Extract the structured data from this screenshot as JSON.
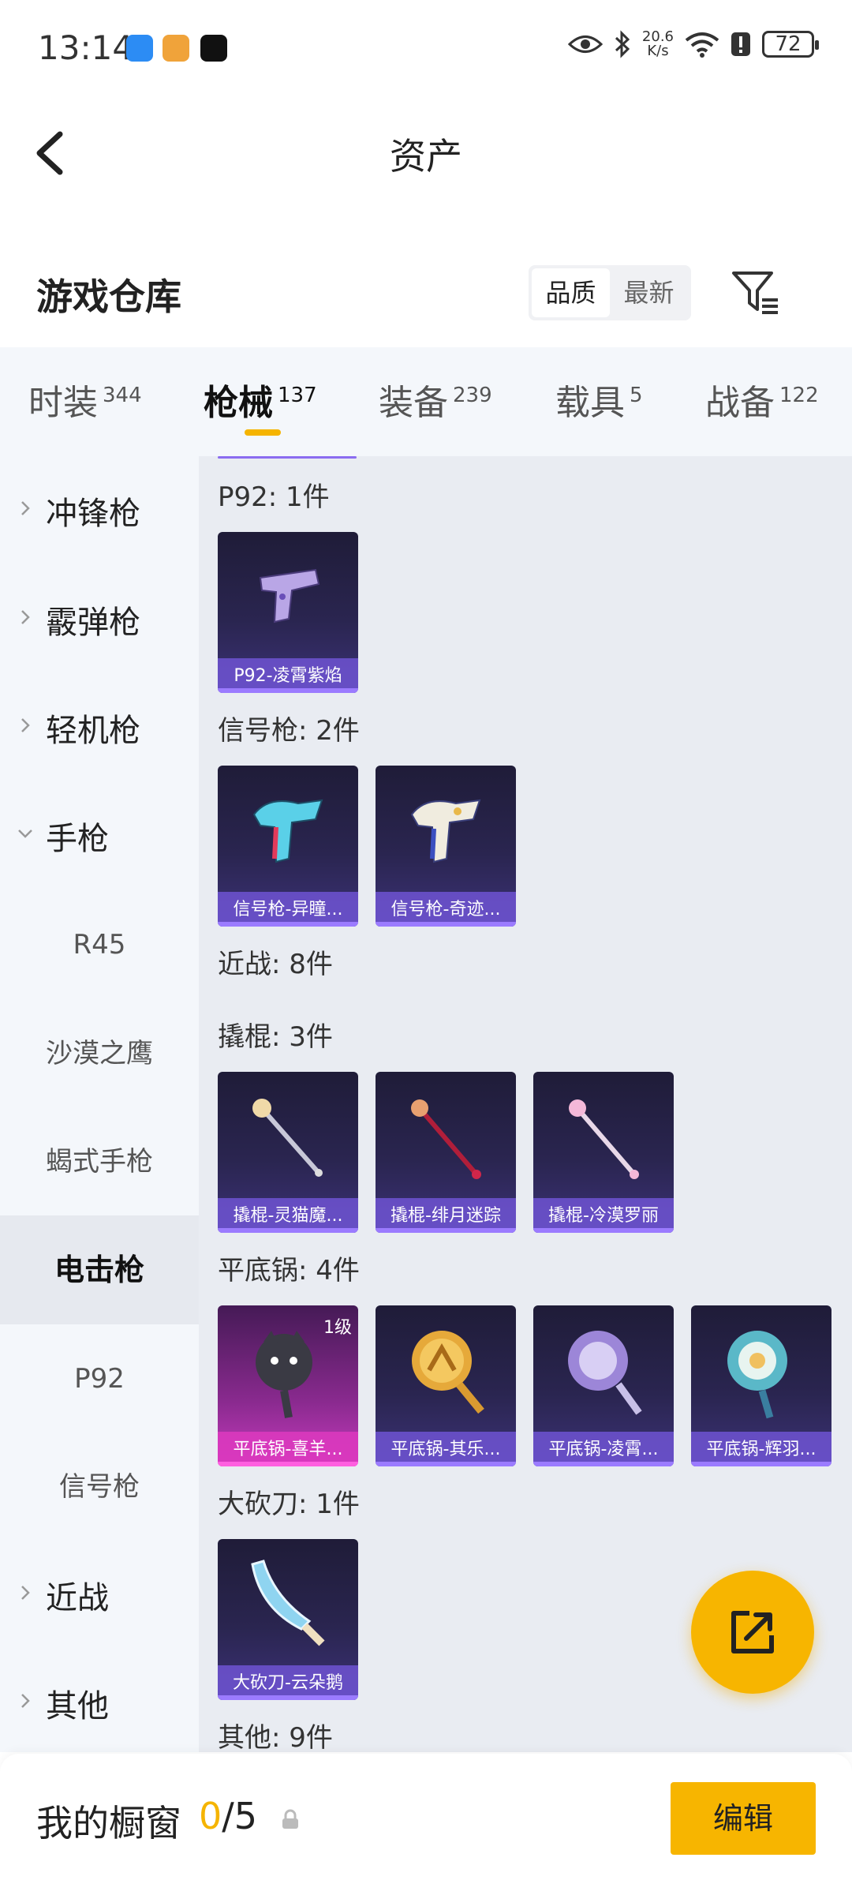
{
  "status_bar": {
    "time": "13:14",
    "net_speed_value": "20.6",
    "net_speed_unit": "K/s",
    "battery": "72"
  },
  "nav": {
    "title": "资产"
  },
  "warehouse": {
    "title": "游戏仓库",
    "sort_options": [
      "品质",
      "最新"
    ],
    "active_sort": "品质"
  },
  "tabs": [
    {
      "label": "时装",
      "count": "344"
    },
    {
      "label": "枪械",
      "count": "137",
      "active": true
    },
    {
      "label": "装备",
      "count": "239"
    },
    {
      "label": "载具",
      "count": "5"
    },
    {
      "label": "战备",
      "count": "122"
    }
  ],
  "sidebar": {
    "groups": [
      {
        "label": "冲锋枪",
        "expanded": false
      },
      {
        "label": "霰弹枪",
        "expanded": false
      },
      {
        "label": "轻机枪",
        "expanded": false
      },
      {
        "label": "手枪",
        "expanded": true
      },
      {
        "label": "近战",
        "expanded": false
      },
      {
        "label": "其他",
        "expanded": false
      }
    ],
    "pistol_subs": [
      "R45",
      "沙漠之鹰",
      "蝎式手枪",
      "电击枪",
      "P92",
      "信号枪"
    ],
    "active_sub": "电击枪"
  },
  "content": {
    "sections": [
      {
        "title": "P92: 1件",
        "items": [
          "P92-凌霄紫焰"
        ]
      },
      {
        "title": "信号枪: 2件",
        "items": [
          "信号枪-异瞳...",
          "信号枪-奇迹..."
        ]
      },
      {
        "title": "近战: 8件",
        "items": []
      },
      {
        "title": "撬棍: 3件",
        "items": [
          "撬棍-灵猫魔...",
          "撬棍-绯月迷踪",
          "撬棍-冷漠罗丽"
        ]
      },
      {
        "title": "平底锅: 4件",
        "items": [
          "平底锅-喜羊...",
          "平底锅-其乐...",
          "平底锅-凌霄...",
          "平底锅-辉羽..."
        ],
        "first_level": "1级"
      },
      {
        "title": "大砍刀: 1件",
        "items": [
          "大砍刀-云朵鹅"
        ]
      },
      {
        "title": "其他: 9件",
        "items": []
      }
    ]
  },
  "bottom": {
    "label": "我的橱窗",
    "count_current": "0",
    "count_total": "/5",
    "edit_label": "编辑"
  },
  "colors": {
    "accent": "#f7b500",
    "card_purple": "#3c3277",
    "card_pink": "#c63bbd"
  }
}
